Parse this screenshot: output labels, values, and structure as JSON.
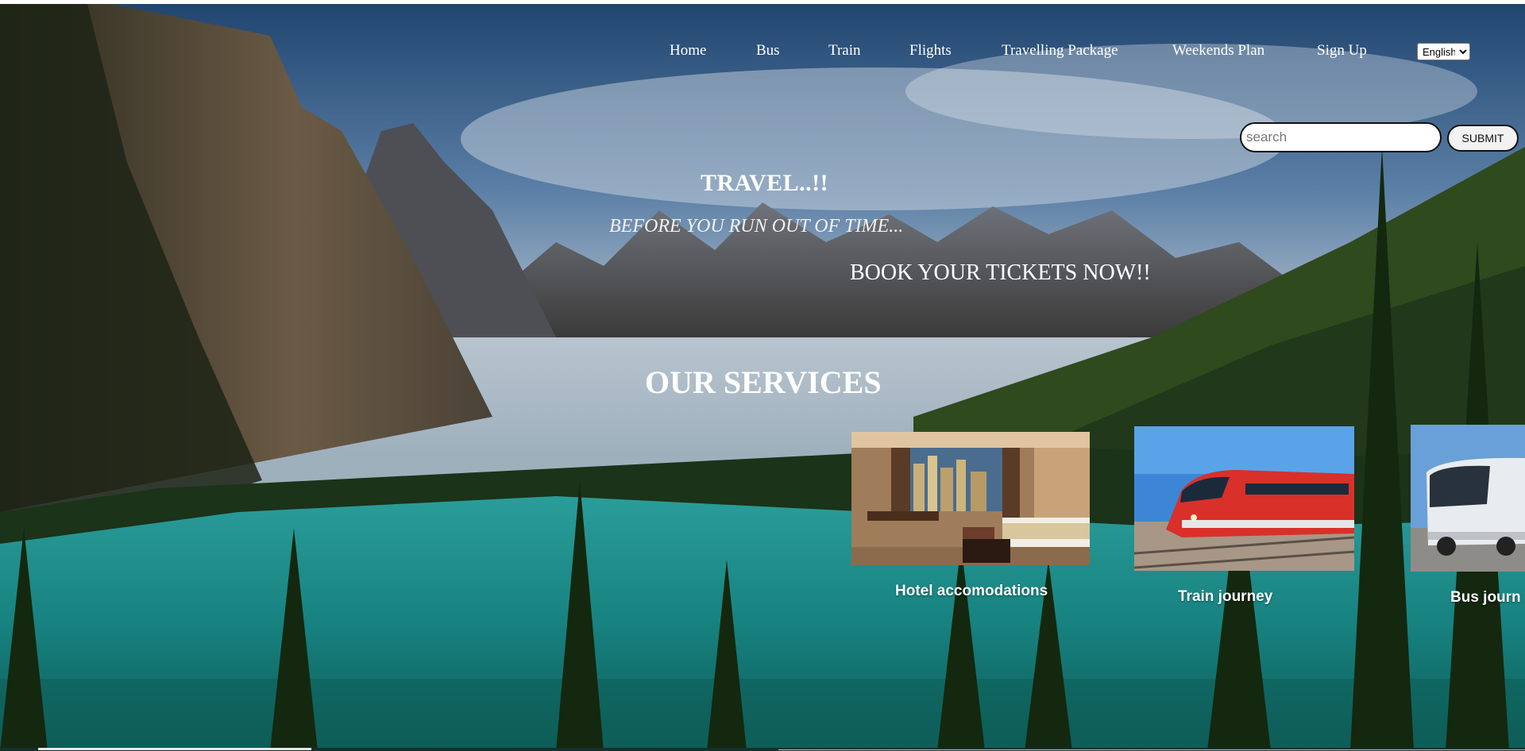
{
  "nav": {
    "items": [
      {
        "label": "Home"
      },
      {
        "label": "Bus"
      },
      {
        "label": "Train"
      },
      {
        "label": "Flights"
      },
      {
        "label": "Travelling Package"
      },
      {
        "label": "Weekends Plan"
      },
      {
        "label": "Sign Up"
      }
    ],
    "language": {
      "selected": "English"
    }
  },
  "search": {
    "placeholder": "search",
    "value": "",
    "submit_label": "SUBMIT"
  },
  "hero": {
    "title": "TRAVEL..!!",
    "subtitle": "BEFORE YOU RUN OUT OF TIME...",
    "cta": "BOOK YOUR TICKETS NOW!!"
  },
  "services": {
    "title": "OUR SERVICES",
    "items": [
      {
        "caption": "Hotel accomodations"
      },
      {
        "caption": "Train journey"
      },
      {
        "caption": "Bus journ"
      }
    ]
  },
  "colors": {
    "text": "#ffffff",
    "sky": "#3b6a9e",
    "lake": "#1a8f8c",
    "forest": "#1f3a1c",
    "train_red": "#d9302a"
  }
}
